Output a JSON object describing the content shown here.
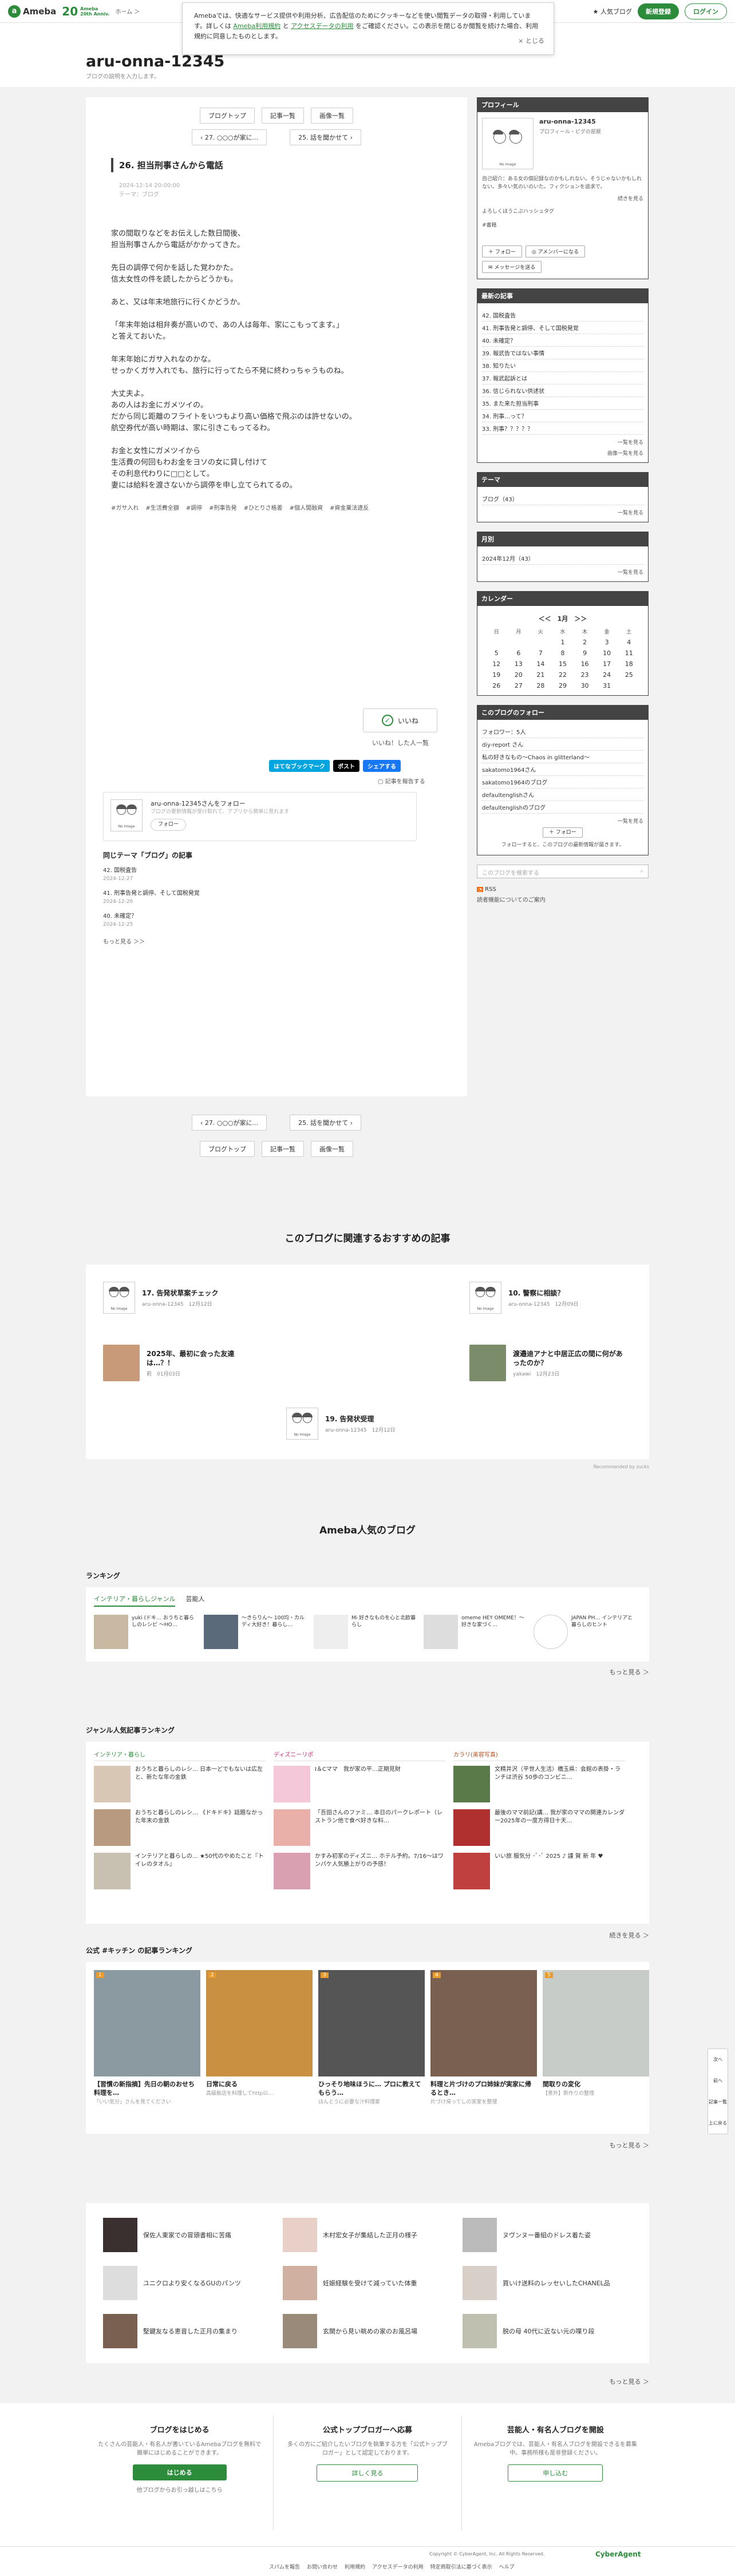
{
  "header": {
    "logo": "Ameba",
    "anniv_big": "20",
    "anniv_top": "Ameba",
    "anniv_bottom": "20th Anniv.",
    "nav": "ホーム ＞",
    "popular": "人気ブログ",
    "signup": "新規登録",
    "login": "ログイン"
  },
  "cookie": {
    "text1": "Amebaでは、快適なサービス提供や利用分析、広告配信のためにクッキーなどを使い閲覧データの取得・利用しています。詳しくは ",
    "link1": "Ameba利用規約",
    "mid": " と ",
    "link2": "アクセスデータの利用",
    "text2": " をご確認ください。この表示を閉じるか閲覧を続けた場合、利用規約に同意したものとします。",
    "close": "× とじる"
  },
  "blog": {
    "title": "aru-onna-12345",
    "desc": "ブログの説明を入力します。"
  },
  "pager": {
    "top_buttons": [
      "ブログトップ",
      "記事一覧",
      "画像一覧"
    ],
    "prev": "‹ 27. ○○○が家に...",
    "next": "25. 話を聞かせて ›"
  },
  "article": {
    "title": "26. 担当刑事さんから電話",
    "date": "2024-12-14 20:00:00",
    "theme": "テーマ：ブログ",
    "paragraphs": [
      "家の間取りなどをお伝えした数日間後、\n担当刑事さんから電話がかかってきた。",
      "先日の調停で何かを話した覚わかた。\n信太女性の件を読したからどうかも。",
      "あと、又は年末地旅行に行くかどうか。",
      "「年末年始は相弁奏が高いので、あの人は毎年、家にこもってます。」\nと答えておいた。",
      "年末年始にガサ入れなのかな。\nせっかくガサ入れでも、旅行に行ってたら不発に終わっちゃうものね。",
      "大丈夫よ。\nあの人はお金にガメツイの。\nだから同じ距離のフライトをいつもより高い価格で飛ぶのは許せないの。\n航空券代が高い時期は、家に引きこもってるわ。",
      "お金と女性にガメツイから\n生活費の何回もわお金をヨソの女に貸し付けて\nその利息代わりに□□として。\n妻には給料を渡さないから調停を申し立てられてるの。"
    ],
    "tags": [
      "#ガサ入れ",
      "#生活費全額",
      "#調停",
      "#刑事告発",
      "#ひとりさ格差",
      "#個人間融資",
      "#資金業法違反"
    ],
    "like": "いいね",
    "like_note": "いいね！した人一覧",
    "share": [
      "はてなブックマーク",
      "ポスト",
      "シェアする"
    ],
    "report": "記事を報告する",
    "follow_title": "aru-onna-12345さんをフォロー",
    "follow_sub": "ブログの更新情報が受け取れて、アプリから簡単に見れます",
    "follow_btn": "フォロー",
    "same_title": "同じテーマ「ブログ」の記事",
    "same": [
      {
        "t": "42. 国税査告",
        "d": "2024-12-27"
      },
      {
        "t": "41. 刑事告発と調停、そして国税発覚",
        "d": "2024-12-26"
      },
      {
        "t": "40. 未確定？",
        "d": "2024-12-25"
      }
    ],
    "same_more": "もっと見る ＞＞"
  },
  "side": {
    "profile": {
      "head": "プロフィール",
      "name": "aru-onna-12345",
      "sub": "プロフィール・ピグの部屋",
      "text": "自己紹介：ある女の個記録なのかもしれない。そうじゃないかもしれない。多々い気のいのいた。フィクションを追求で。",
      "more": "続きを見る",
      "note": "よろしくほうこぶハッシュタグ",
      "tag": "#書籍",
      "follow": "フォロー",
      "ameba": "アメンバーになる",
      "msg": "メッセージを送る"
    },
    "recent": {
      "head": "最新の記事",
      "items": [
        "42. 国税査告",
        "41. 刑事告発と調停、そして国税発覚",
        "40. 未確定？",
        "39. 報武告ではない事情",
        "38. 知りたい",
        "37. 報武起訴とは",
        "36. 信じられない供述状",
        "35. また来た担当刑事",
        "34. 刑事…って？",
        "33. 刑事？？？？？"
      ],
      "more": "一覧を見る",
      "img": "画像一覧を見る"
    },
    "theme": {
      "head": "テーマ",
      "item": "ブログ（43）",
      "more": "一覧を見る"
    },
    "month": {
      "head": "月別",
      "item": "2024年12月（43）",
      "more": "一覧を見る"
    },
    "calendar": {
      "head": "カレンダー",
      "title": "＜＜　1月　＞＞",
      "days": [
        "日",
        "月",
        "火",
        "水",
        "木",
        "金",
        "土"
      ],
      "dates": [
        "",
        "",
        "",
        "1",
        "2",
        "3",
        "4",
        "5",
        "6",
        "7",
        "8",
        "9",
        "10",
        "11",
        "12",
        "13",
        "14",
        "15",
        "16",
        "17",
        "18",
        "19",
        "20",
        "21",
        "22",
        "23",
        "24",
        "25",
        "26",
        "27",
        "28",
        "29",
        "30",
        "31",
        ""
      ]
    },
    "follow": {
      "head": "このブログのフォロー",
      "items": [
        "フォロワー：5人",
        "diy-report さん",
        "私の好きなもの〜Chaos in glitterland〜",
        "sakatomo1964さん",
        "sakatomo1964のブログ",
        "defaultenglishさん",
        "defaultenglishのブログ"
      ],
      "more": "一覧を見る",
      "btn": "フォロー",
      "note": "フォローすると、このブログの最新情報が届きます。"
    },
    "search": "このブログを検索する",
    "rss": "RSS",
    "rss_note": "読者機能についてのご案内"
  },
  "rec": {
    "title": "このブログに関連するおすすめの記事",
    "items": [
      {
        "t": "17. 告発状草案チェック",
        "m": "aru-onna-12345　12月12日"
      },
      {
        "t": "10. 警察に相談？",
        "m": "aru-onna-12345　12月09日"
      },
      {
        "t": "2025年、最初に会った友達は…？！",
        "m": "莉　01月03日"
      },
      {
        "t": "渡邉迪アナと中居正広の間に何があったのか？",
        "m": "yakawi　12月23日"
      },
      {
        "t": "19. 告発状受理",
        "m": "aru-onna-12345　12月12日"
      }
    ],
    "powered": "Recommended by zucks"
  },
  "popular": {
    "title": "Ameba人気のブログ",
    "rank_h": "ランキング",
    "tabs": [
      "インテリア・暮らしジャンル",
      "芸能人"
    ],
    "ranks": [
      "yuki (ドキ… おうちと暮らしのレシピ ～HO…",
      "～きらりん～ 100均・カルディ大好き！暮らし…",
      "Mi 好きなものを心と北欧暮らし",
      "omeme HEY OMEME！〜好きな家づく…",
      "JAPAN PH… インテリアと暮らしのヒント"
    ],
    "rank_more": "もっと見る ＞",
    "genre_h": "ジャンル人気記事ランキング",
    "genres": [
      {
        "name": "インテリア・暮らし",
        "items": [
          "おうちと暮らしのレシ… 日本一どでもないは広左と、新たな年の金鉄",
          "おうちと暮らしのレシ… 《ドキドキ》話題なかった年末の金鉄",
          "インテリアと暮らしの… ★50代のやめたこと『トイレのタオル』"
        ]
      },
      {
        "name": "ディズニーリポ",
        "items": [
          "I＆Cママ　我が家の平…正期見財",
          "「吾田さんのファミ… 本日のパークレポート（レストラン他で食べ好きな料…",
          "かすみ初家のディズニ… ホテル予約。7/16〜はワンパケ人気勝上がりの予感！"
        ]
      },
      {
        "name": "カラリ(美容写真)",
        "items": [
          "文精井沢（平世人生活）橋玉県：会館の表掛・ランチは渋谷 50歩のコンビニ…",
          "最後のママ前記(講… 我が家のママの関連カレンダー2025年の一度方得日十天…",
          "いい旅 服気分 ･ﾟ･ﾟ 2025 ♪ 謹 賀 新 年 ♥"
        ]
      }
    ],
    "genre_more": "続きを見る ＞",
    "kitchen_h": "公式 #キッチン の記事ランキング",
    "cards": [
      {
        "t": "【習慣の新指摘】先日の朝のおせち料理を…",
        "s": "「いい気分」さんを見てください"
      },
      {
        "t": "日常に戻る",
        "s": "高級飯店を料理してhttp以…"
      },
      {
        "t": "ひっそり地味ほうに… プロに教えてもらう…",
        "s": "ほんとうに必要な汁料理家"
      },
      {
        "t": "料理と片づけのプロ姉妹が実家に帰るとき…",
        "s": "片づけ帰ってしの実家を整理"
      },
      {
        "t": "間取りの変化",
        "s": "【意外】新作りの整理"
      }
    ],
    "kitchen_more": "もっと見る ＞",
    "celebs": [
      "保佐人東家での冒頭書相に苦痛",
      "木村宏女子が集結した正月の様子",
      "ヌヴンヌー番組のドレス着た姿",
      "ユニクロより安くなるGUのパンツ",
      "妊娠経験を受けて減っていた体重",
      "買いけ送料のレッセいしたCHANEL品",
      "堅鍵友なる恵音した正月の集まり",
      "玄関から見い眺めの家のお風呂場",
      "脱の母 40代に近ない元の喋り段"
    ],
    "celeb_more": "もっと見る ＞"
  },
  "promo": [
    {
      "h": "ブログをはじめる",
      "p": "たくさんの芸能人・有名人が書いているAmebaブログを無料で簡単にはじめることができます。",
      "b": "はじめる",
      "n": "他ブログからお引っ越しはこちら"
    },
    {
      "h": "公式トップブロガーへ応募",
      "p": "多くの方にご紹介したいブログを執筆する方を「公式トップブロガー」として認定しております。",
      "b": "詳しく見る"
    },
    {
      "h": "芸能人・有名人ブログを開設",
      "p": "Amebaブログでは、芸能人・有名人ブログを開設できるを募集中。事務所様も是非登録ください。",
      "b": "申し込む"
    }
  ],
  "footer": {
    "links": [
      "スパムを報告",
      "お問い合わせ",
      "利用規約",
      "アクセスデータの利用",
      "特定商取引法に基づく表示",
      "ヘルプ"
    ],
    "copy": "Copyright © CyberAgent, Inc. All Rights Reserved.",
    "ca": "CyberAgent"
  },
  "float": [
    "次へ",
    "前へ",
    "記事一覧",
    "上に戻る"
  ],
  "colors": {
    "accent": "#2d8c3c",
    "sidebar_head": "#444444"
  }
}
